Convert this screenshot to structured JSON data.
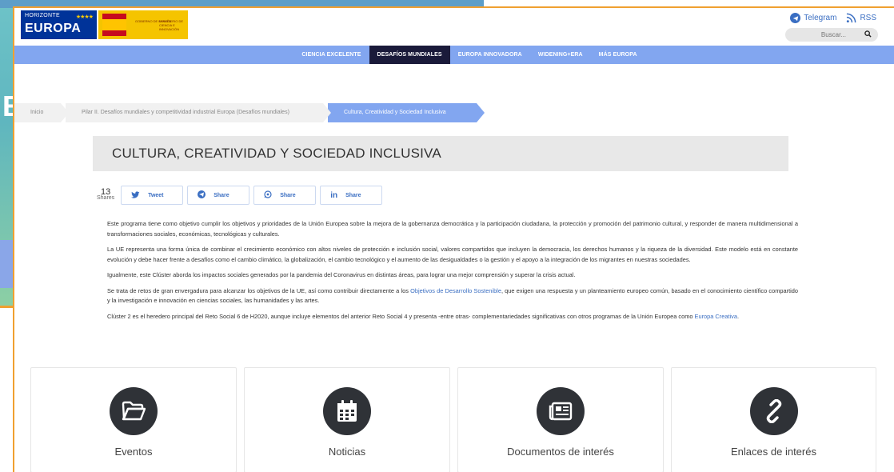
{
  "header": {
    "eu_logo": {
      "small": "HORIZONTE",
      "big": "EUROPA"
    },
    "gov_logo": {
      "line1": "GOBIERNO DE ESPAÑA",
      "line2": "MINISTERIO DE CIENCIA E INNOVACIÓN"
    },
    "telegram_label": "Telegram",
    "rss_label": "RSS",
    "search_placeholder": "Buscar..."
  },
  "nav": {
    "items": [
      {
        "label": "CIENCIA EXCELENTE"
      },
      {
        "label": "DESAFÍOS MUNDIALES"
      },
      {
        "label": "EUROPA INNOVADORA"
      },
      {
        "label": "WIDENING+ERA"
      },
      {
        "label": "MÁS EUROPA"
      }
    ],
    "active_index": 1
  },
  "breadcrumb": [
    "Inicio",
    "Pilar II. Desafíos mundiales y competitividad industrial Europa (Desafíos mundiales)",
    "Cultura, Creatividad y Sociedad Inclusiva"
  ],
  "page_title": "CULTURA, CREATIVIDAD Y SOCIEDAD INCLUSIVA",
  "share": {
    "count": "13",
    "count_label": "Shares",
    "buttons": [
      "Tweet",
      "Share",
      "Share",
      "Share"
    ]
  },
  "content": {
    "p1": "Este programa tiene como objetivo cumplir los objetivos y prioridades de la Unión Europea sobre la mejora de la gobernanza democrática y la participación ciudadana, la protección y promoción del patrimonio cultural, y responder de manera multidimensional a transformaciones sociales, económicas, tecnológicas y culturales.",
    "p2": "La UE representa una forma única de combinar el crecimiento económico con altos niveles de protección e inclusión social, valores compartidos que incluyen la democracia, los derechos humanos y la riqueza de la diversidad. Este modelo está en constante evolución y debe hacer frente a desafíos como el cambio climático, la globalización, el cambio tecnológico y el aumento de las desigualdades o la gestión y el apoyo a la integración de los migrantes en nuestras sociedades.",
    "p3": "Igualmente, este Clúster aborda los impactos sociales generados por la pandemia del Coronavirus en distintas áreas, para lograr una mejor comprensión y superar la crisis actual.",
    "p4_a": "Se trata de retos de gran envergadura para alcanzar los objetivos de la UE, así como contribuir directamente a los ",
    "p4_link": "Objetivos de Desarrollo Sostenible",
    "p4_b": ", que exigen una respuesta y  un planteamiento europeo común, basado en el conocimiento científico compartido y la investigación e innovación en ciencias sociales, las humanidades y las artes.",
    "p5_a": "Clúster 2 es el heredero principal del Reto Social 6 de H2020, aunque incluye elementos del anterior Reto Social 4 y presenta -entre otras- complementariedades significativas con otros programas de la Unión Europea como ",
    "p5_link": "Europa Creativa",
    "p5_b": "."
  },
  "cards": [
    {
      "label": "Eventos",
      "icon": "folder-icon"
    },
    {
      "label": "Noticias",
      "icon": "calendar-icon"
    },
    {
      "label": "Documentos de interés",
      "icon": "newspaper-icon"
    },
    {
      "label": "Enlaces de interés",
      "icon": "link-icon"
    }
  ],
  "colors": {
    "nav": "#82a6f0",
    "nav_active": "#1a1a3a",
    "link": "#3a6ec2",
    "card_circle": "#2f3237"
  }
}
